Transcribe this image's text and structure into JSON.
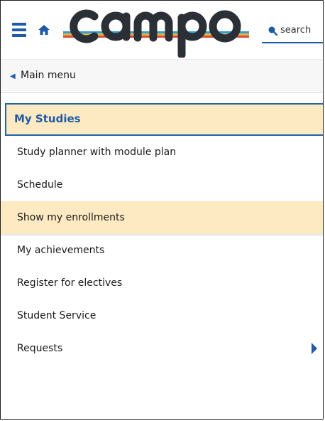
{
  "header": {
    "logo_text": "campo",
    "search": {
      "placeholder": "search",
      "value": ""
    },
    "icons": {
      "menu": "hamburger-icon",
      "home": "home-icon",
      "search": "search-icon"
    }
  },
  "breadcrumb": {
    "back_label": "Main menu",
    "icon": "chevron-left-icon"
  },
  "section": {
    "title": "My Studies"
  },
  "menu": {
    "items": [
      {
        "label": "Study planner with module plan"
      },
      {
        "label": "Schedule"
      },
      {
        "label": "Show my enrollments",
        "selected": true
      },
      {
        "label": "My achievements"
      },
      {
        "label": "Register for electives"
      },
      {
        "label": "Student Service"
      },
      {
        "label": "Requests",
        "has_submenu": true,
        "icon": "chevron-right-icon"
      }
    ]
  },
  "colors": {
    "accent": "#1f5aa6",
    "highlight": "#fdeac3",
    "section_border": "#1e64ad"
  }
}
